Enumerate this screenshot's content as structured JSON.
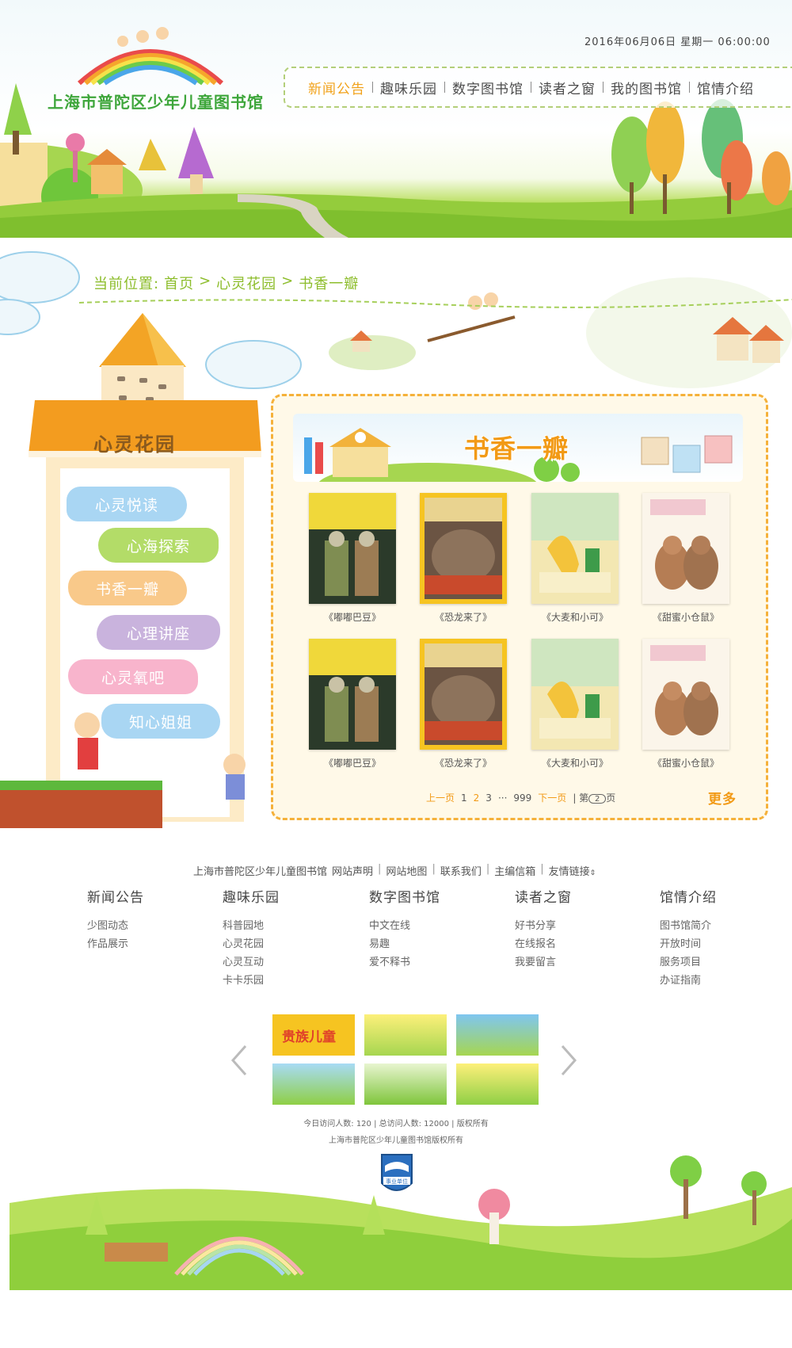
{
  "header": {
    "site_title": "上海市普陀区少年儿童图书馆",
    "datetime": "2016年06月06日  星期一  06:00:00",
    "nav": [
      {
        "label": "新闻公告",
        "active": true
      },
      {
        "label": "趣味乐园",
        "active": false
      },
      {
        "label": "数字图书馆",
        "active": false
      },
      {
        "label": "读者之窗",
        "active": false
      },
      {
        "label": "我的图书馆",
        "active": false
      },
      {
        "label": "馆情介绍",
        "active": false
      }
    ]
  },
  "breadcrumb": {
    "prefix": "当前位置:",
    "items": [
      "首页",
      "心灵花园",
      "书香一瓣"
    ],
    "separator": ">"
  },
  "sidebar": {
    "title": "心灵花园",
    "items": [
      {
        "label": "心灵悦读",
        "color": "#a9d6f3"
      },
      {
        "label": "心海探索",
        "color": "#b3dc68"
      },
      {
        "label": "书香一瓣",
        "color": "#f9c98a"
      },
      {
        "label": "心理讲座",
        "color": "#c9b3dd"
      },
      {
        "label": "心灵氧吧",
        "color": "#f8b4cc"
      },
      {
        "label": "知心姐姐",
        "color": "#a9d6f3"
      }
    ]
  },
  "main": {
    "banner_title": "书香一瓣",
    "books": [
      {
        "caption": "《嘟嘟巴豆》",
        "cover": "dudu"
      },
      {
        "caption": "《恐龙来了》",
        "cover": "dino"
      },
      {
        "caption": "《大麦和小可》",
        "cover": "damai"
      },
      {
        "caption": "《甜蜜小仓鼠》",
        "cover": "hamster"
      },
      {
        "caption": "《嘟嘟巴豆》",
        "cover": "dudu"
      },
      {
        "caption": "《恐龙来了》",
        "cover": "dino"
      },
      {
        "caption": "《大麦和小可》",
        "cover": "damai"
      },
      {
        "caption": "《甜蜜小仓鼠》",
        "cover": "hamster"
      }
    ],
    "pager": {
      "prev": "上一页",
      "pages": [
        "1",
        "2",
        "3",
        "···",
        "999"
      ],
      "current_page": "2",
      "next": "下一页",
      "goto_prefix": "第",
      "goto_value": "2",
      "goto_suffix": "页"
    },
    "more": "更多"
  },
  "footer": {
    "links": [
      "上海市普陀区少年儿童图书馆",
      "网站声明",
      "网站地图",
      "联系我们",
      "主编信箱",
      "友情链接"
    ],
    "columns": [
      {
        "title": "新闻公告",
        "items": [
          "少图动态",
          "作品展示"
        ]
      },
      {
        "title": "趣味乐园",
        "items": [
          "科普园地",
          "心灵花园",
          "心灵互动",
          "卡卡乐园"
        ]
      },
      {
        "title": "数字图书馆",
        "items": [
          "中文在线",
          "易趣",
          "爱不释书"
        ]
      },
      {
        "title": "读者之窗",
        "items": [
          "好书分享",
          "在线报名",
          "我要留言"
        ]
      },
      {
        "title": "馆情介绍",
        "items": [
          "图书馆简介",
          "开放时间",
          "服务项目",
          "办证指南"
        ]
      }
    ],
    "partners": [
      "贵族儿童",
      "",
      "",
      "",
      "",
      ""
    ],
    "stats_line": "今日访问人数:  120  |  总访问人数:  12000  |  版权所有",
    "copyright": "上海市普陀区少年儿童图书馆版权所有",
    "badge_label": "事业单位"
  }
}
